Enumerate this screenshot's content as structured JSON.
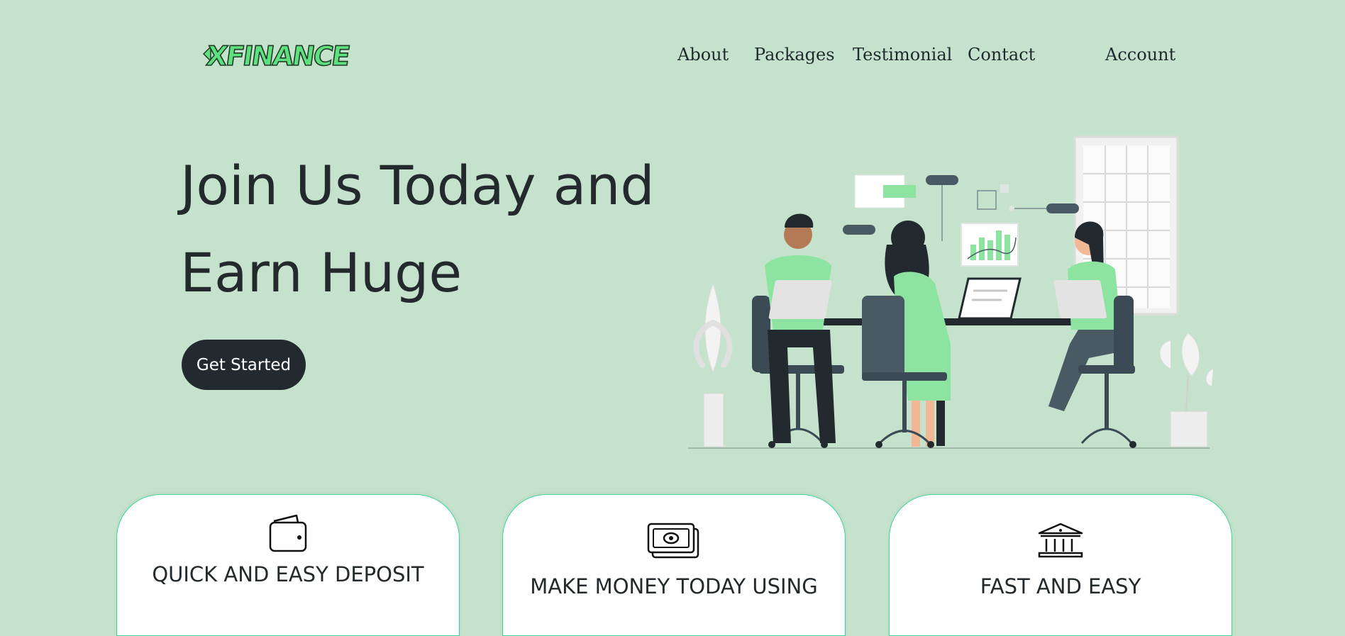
{
  "brand": {
    "logo_text": "XFINANCE",
    "accent_color": "#5ee07f"
  },
  "nav": {
    "links": [
      {
        "label": "About"
      },
      {
        "label": "Packages"
      },
      {
        "label": "Testimonial"
      },
      {
        "label": "Contact"
      },
      {
        "label": "Account"
      }
    ]
  },
  "hero": {
    "title_line1": "Join Us Today and",
    "title_line2": "Earn Huge",
    "cta_label": "Get Started",
    "illustration": "team-working-at-desk-illustration"
  },
  "features": [
    {
      "icon": "wallet-icon",
      "title": "QUICK AND EASY DEPOSIT"
    },
    {
      "icon": "cash-icon",
      "title": "MAKE MONEY TODAY USING"
    },
    {
      "icon": "bank-icon",
      "title": "FAST AND EASY"
    }
  ],
  "colors": {
    "background": "#c5e3cc",
    "dark": "#232a2f",
    "card_border": "#3cd59a"
  }
}
